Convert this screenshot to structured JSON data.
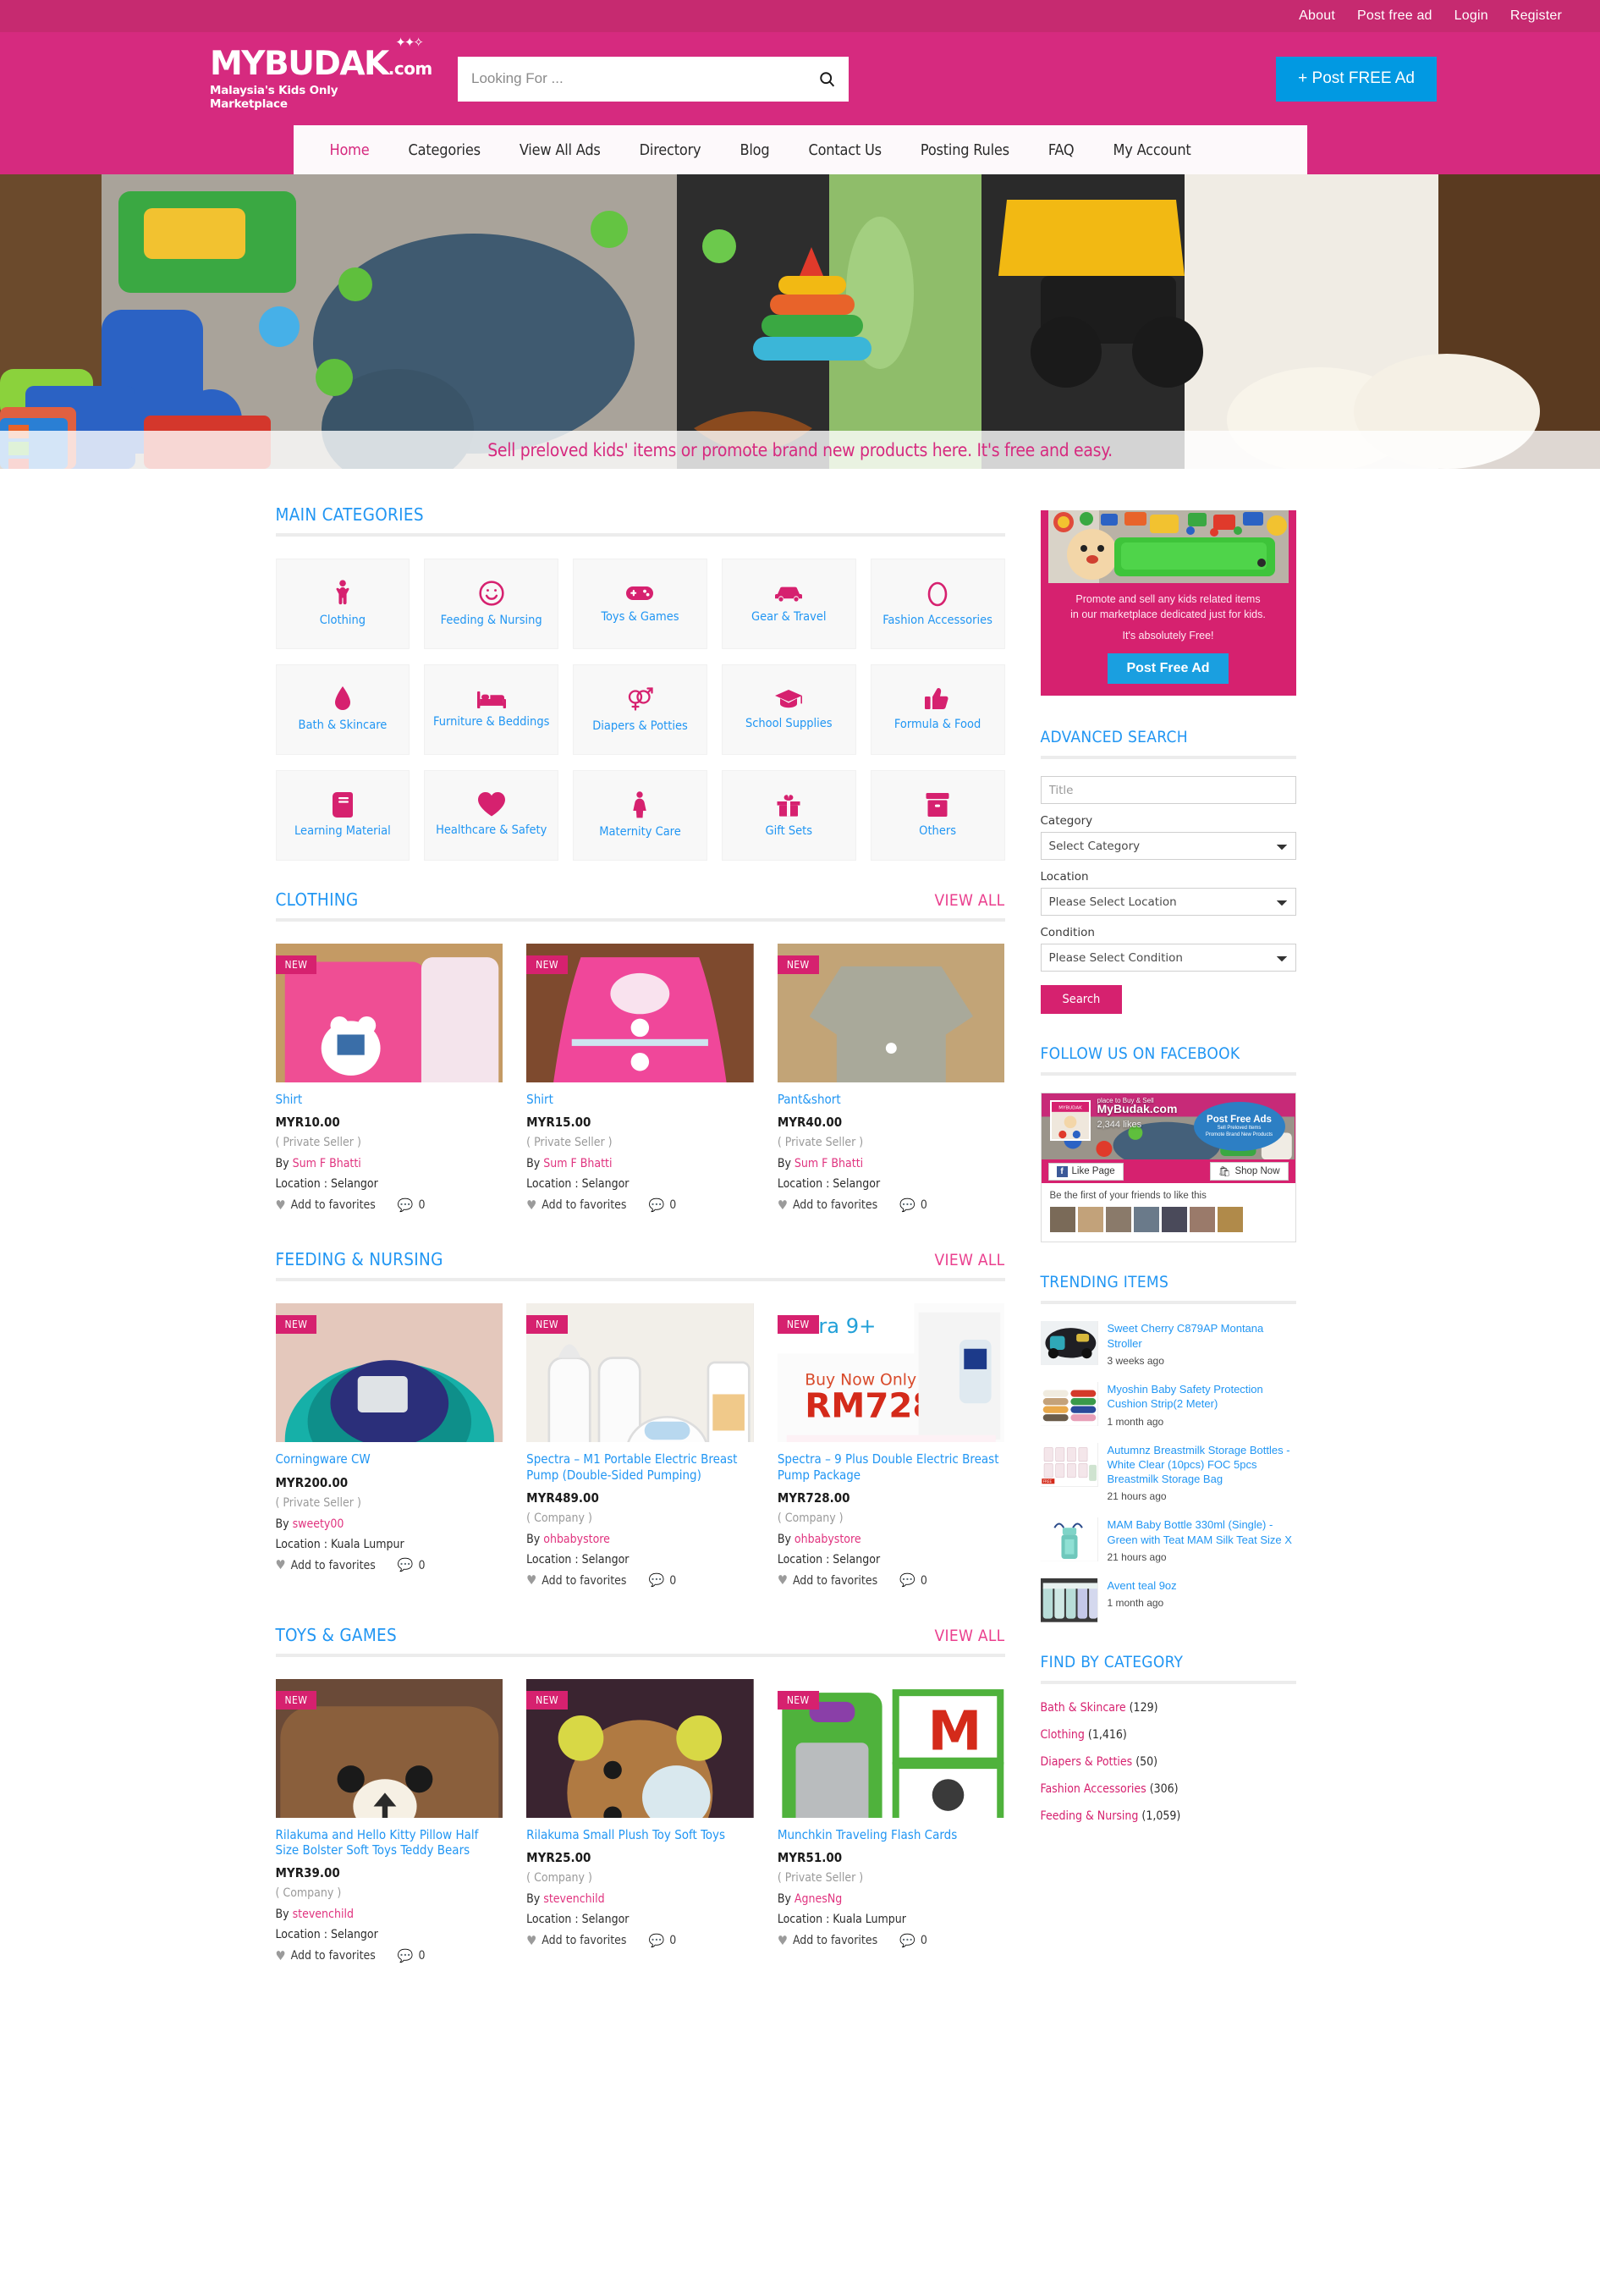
{
  "topbar": {
    "links": [
      {
        "label": "About"
      },
      {
        "label": "Post free ad"
      },
      {
        "label": "Login"
      },
      {
        "label": "Register"
      }
    ]
  },
  "header": {
    "logo_main": "MYBUDAK",
    "logo_dotcom": ".com",
    "logo_tagline": "Malaysia's Kids Only Marketplace",
    "search_placeholder": "Looking For ...",
    "search_value": "",
    "post_ad_label": "+ Post FREE Ad"
  },
  "nav": {
    "items": [
      {
        "label": "Home",
        "active": true
      },
      {
        "label": "Categories",
        "active": false
      },
      {
        "label": "View All Ads",
        "active": false
      },
      {
        "label": "Directory",
        "active": false
      },
      {
        "label": "Blog",
        "active": false
      },
      {
        "label": "Contact Us",
        "active": false
      },
      {
        "label": "Posting Rules",
        "active": false
      },
      {
        "label": "FAQ",
        "active": false
      },
      {
        "label": "My Account",
        "active": false
      }
    ]
  },
  "hero": {
    "tagline": "Sell preloved kids' items or promote brand new products here. It's free and easy."
  },
  "main_categories": {
    "title": "MAIN CATEGORIES",
    "items": [
      {
        "label": "Clothing",
        "icon": "child-icon"
      },
      {
        "label": "Feeding & Nursing",
        "icon": "smiley-icon"
      },
      {
        "label": "Toys & Games",
        "icon": "gamepad-icon"
      },
      {
        "label": "Gear & Travel",
        "icon": "car-icon"
      },
      {
        "label": "Fashion Accessories",
        "icon": "ring-icon"
      },
      {
        "label": "Bath & Skincare",
        "icon": "droplet-icon"
      },
      {
        "label": "Furniture & Beddings",
        "icon": "bed-icon"
      },
      {
        "label": "Diapers & Potties",
        "icon": "gender-icon"
      },
      {
        "label": "School Supplies",
        "icon": "graduation-cap-icon"
      },
      {
        "label": "Formula & Food",
        "icon": "thumbs-up-icon"
      },
      {
        "label": "Learning Material",
        "icon": "book-icon"
      },
      {
        "label": "Healthcare & Safety",
        "icon": "heart-icon"
      },
      {
        "label": "Maternity Care",
        "icon": "woman-icon"
      },
      {
        "label": "Gift Sets",
        "icon": "gift-icon"
      },
      {
        "label": "Others",
        "icon": "box-icon"
      }
    ]
  },
  "sections": [
    {
      "title": "CLOTHING",
      "view_all": "VIEW ALL",
      "products": [
        {
          "badge": "NEW",
          "title": "Shirt",
          "price": "MYR10.00",
          "seller_type": "( Private Seller )",
          "by_prefix": "By",
          "by": "Sum F Bhatti",
          "location": "Location : Selangor",
          "fav_label": "Add to favorites",
          "comments": "0",
          "img": "pink-bear-shirt"
        },
        {
          "badge": "NEW",
          "title": "Shirt",
          "price": "MYR15.00",
          "seller_type": "( Private Seller )",
          "by_prefix": "By",
          "by": "Sum F Bhatti",
          "location": "Location : Selangor",
          "fav_label": "Add to favorites",
          "comments": "0",
          "img": "pink-frill-dress"
        },
        {
          "badge": "NEW",
          "title": "Pant&short",
          "price": "MYR40.00",
          "seller_type": "( Private Seller )",
          "by_prefix": "By",
          "by": "Sum F Bhatti",
          "location": "Location : Selangor",
          "fav_label": "Add to favorites",
          "comments": "0",
          "img": "grey-shirt"
        }
      ]
    },
    {
      "title": "FEEDING & NURSING",
      "view_all": "VIEW ALL",
      "products": [
        {
          "badge": "NEW",
          "title": "Corningware CW",
          "price": "MYR200.00",
          "seller_type": "( Private Seller )",
          "by_prefix": "By",
          "by": "sweety00",
          "location": "Location : Kuala Lumpur",
          "fav_label": "Add to favorites",
          "comments": "0",
          "img": "teal-bowls"
        },
        {
          "badge": "NEW",
          "title": "Spectra – M1 Portable Electric Breast Pump (Double-Sided Pumping)",
          "price": "MYR489.00",
          "seller_type": "( Company )",
          "by_prefix": "By",
          "by": "ohbabystore",
          "location": "Location : Selangor",
          "fav_label": "Add to favorites",
          "comments": "0",
          "img": "breast-pump-m1"
        },
        {
          "badge": "NEW",
          "title": "Spectra – 9 Plus Double Electric Breast Pump Package",
          "price": "MYR728.00",
          "seller_type": "( Company )",
          "by_prefix": "By",
          "by": "ohbabystore",
          "location": "Location : Selangor",
          "fav_label": "Add to favorites",
          "comments": "0",
          "img": "spectra-9-plus"
        }
      ]
    },
    {
      "title": "TOYS & GAMES",
      "view_all": "VIEW ALL",
      "products": [
        {
          "badge": "NEW",
          "title": "Rilakuma and Hello Kitty Pillow Half Size Bolster Soft Toys Teddy Bears",
          "price": "MYR39.00",
          "seller_type": "( Company )",
          "by_prefix": "By",
          "by": "stevenchild",
          "location": "Location : Selangor",
          "fav_label": "Add to favorites",
          "comments": "0",
          "img": "brown-bear-pillow"
        },
        {
          "badge": "NEW",
          "title": "Rilakuma Small Plush Toy Soft Toys",
          "price": "MYR25.00",
          "seller_type": "( Company )",
          "by_prefix": "By",
          "by": "stevenchild",
          "location": "Location : Selangor",
          "fav_label": "Add to favorites",
          "comments": "0",
          "img": "plush-bear"
        },
        {
          "badge": "NEW",
          "title": "Munchkin Traveling Flash Cards",
          "price": "MYR51.00",
          "seller_type": "( Private Seller )",
          "by_prefix": "By",
          "by": "AgnesNg",
          "location": "Location : Kuala Lumpur",
          "fav_label": "Add to favorites",
          "comments": "0",
          "img": "flash-cards"
        }
      ]
    }
  ],
  "sidebar": {
    "ad": {
      "line1": "Promote and sell any kids related items",
      "line2": "in our marketplace dedicated just for kids.",
      "line3": "It's absolutely Free!",
      "button": "Post Free Ad"
    },
    "advanced_search": {
      "title": "ADVANCED SEARCH",
      "title_placeholder": "Title",
      "title_value": "",
      "category_label": "Category",
      "category_value": "Select Category",
      "location_label": "Location",
      "location_value": "Please Select Location",
      "condition_label": "Condition",
      "condition_value": "Please Select Condition",
      "search_button": "Search"
    },
    "facebook": {
      "title": "FOLLOW US ON FACEBOOK",
      "cover_sub": "place to Buy & Sell",
      "page_name": "MyBudak.com",
      "likes": "2,344  likes",
      "bubble_title": "Post Free Ads",
      "bubble_l1": "Sell Preloved Items",
      "bubble_l2": "Promote Brand New Products",
      "like_button": "Like Page",
      "shop_button": "Shop Now",
      "footer_text": "Be the first of your friends to like this"
    },
    "trending": {
      "title": "TRENDING ITEMS",
      "items": [
        {
          "title": "Sweet Cherry C879AP Montana Stroller",
          "time": "3 weeks ago",
          "img": "stroller"
        },
        {
          "title": "Myoshin Baby Safety Protection Cushion Strip(2 Meter)",
          "time": "1 month ago",
          "img": "cushion-strips"
        },
        {
          "title": "Autumnz Breastmilk Storage Bottles - White Clear (10pcs) FOC 5pcs Breastmilk Storage Bag",
          "time": "21 hours ago",
          "img": "storage-bottles"
        },
        {
          "title": "MAM Baby Bottle 330ml (Single) - Green with Teat MAM Silk Teat Size X",
          "time": "21 hours ago",
          "img": "mam-bottle"
        },
        {
          "title": "Avent teal 9oz",
          "time": "1 month ago",
          "img": "avent-bottles"
        }
      ]
    },
    "find_by_category": {
      "title": "FIND BY CATEGORY",
      "items": [
        {
          "name": "Bath & Skincare",
          "count": "(129)"
        },
        {
          "name": "Clothing",
          "count": "(1,416)"
        },
        {
          "name": "Diapers & Potties",
          "count": "(50)"
        },
        {
          "name": "Fashion Accessories",
          "count": "(306)"
        },
        {
          "name": "Feeding & Nursing",
          "count": "(1,059)"
        }
      ]
    }
  },
  "colors": {
    "brand_pink": "#d62a7f",
    "deep_pink": "#c62a70",
    "icon_pink": "#d6216f",
    "accent_blue": "#2196f3",
    "button_blue": "#0199e2",
    "viewall_pink": "#ea3f8e"
  }
}
